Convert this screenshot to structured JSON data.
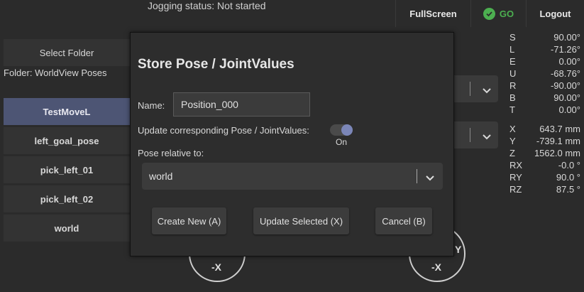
{
  "header": {
    "jogging_status": "Jogging status: Not started",
    "fullscreen_label": "FullScreen",
    "go_label": "GO",
    "logout_label": "Logout"
  },
  "sidebar": {
    "select_folder_label": "Select Folder",
    "folder_text": "Folder: WorldView Poses",
    "poses": [
      {
        "label": "TestMoveL",
        "selected": true
      },
      {
        "label": "left_goal_pose",
        "selected": false
      },
      {
        "label": "pick_left_01",
        "selected": false
      },
      {
        "label": "pick_left_02",
        "selected": false
      },
      {
        "label": "world",
        "selected": false
      }
    ]
  },
  "joints": [
    {
      "name": "S",
      "value": "90.00°"
    },
    {
      "name": "L",
      "value": "-71.26°"
    },
    {
      "name": "E",
      "value": "0.00°"
    },
    {
      "name": "U",
      "value": "-68.76°"
    },
    {
      "name": "R",
      "value": "-90.00°"
    },
    {
      "name": "B",
      "value": "90.00°"
    },
    {
      "name": "T",
      "value": "0.00°"
    }
  ],
  "cartesian": [
    {
      "name": "X",
      "value": "643.7 mm"
    },
    {
      "name": "Y",
      "value": "-739.1 mm"
    },
    {
      "name": "Z",
      "value": "1562.0 mm"
    },
    {
      "name": "RX",
      "value": "-0.0 °"
    },
    {
      "name": "RY",
      "value": "90.0 °"
    },
    {
      "name": "RZ",
      "value": "87.5 °"
    }
  ],
  "jog": {
    "left_label": "-X",
    "right_label": "-X",
    "right_axis_label": "Y"
  },
  "dialog": {
    "title": "Store Pose / JointValues",
    "name_label": "Name:",
    "name_value": "Position_000",
    "update_label": "Update corresponding Pose / JointValues:",
    "update_state": "On",
    "relative_label": "Pose relative to:",
    "relative_value": "world",
    "create_button": "Create New (A)",
    "update_button": "Update Selected (X)",
    "cancel_button": "Cancel (B)"
  },
  "colors": {
    "background": "#2b2b2b",
    "selected_item": "#4d5574",
    "go_green": "#4caf50",
    "toggle_on": "#7b86b8"
  }
}
